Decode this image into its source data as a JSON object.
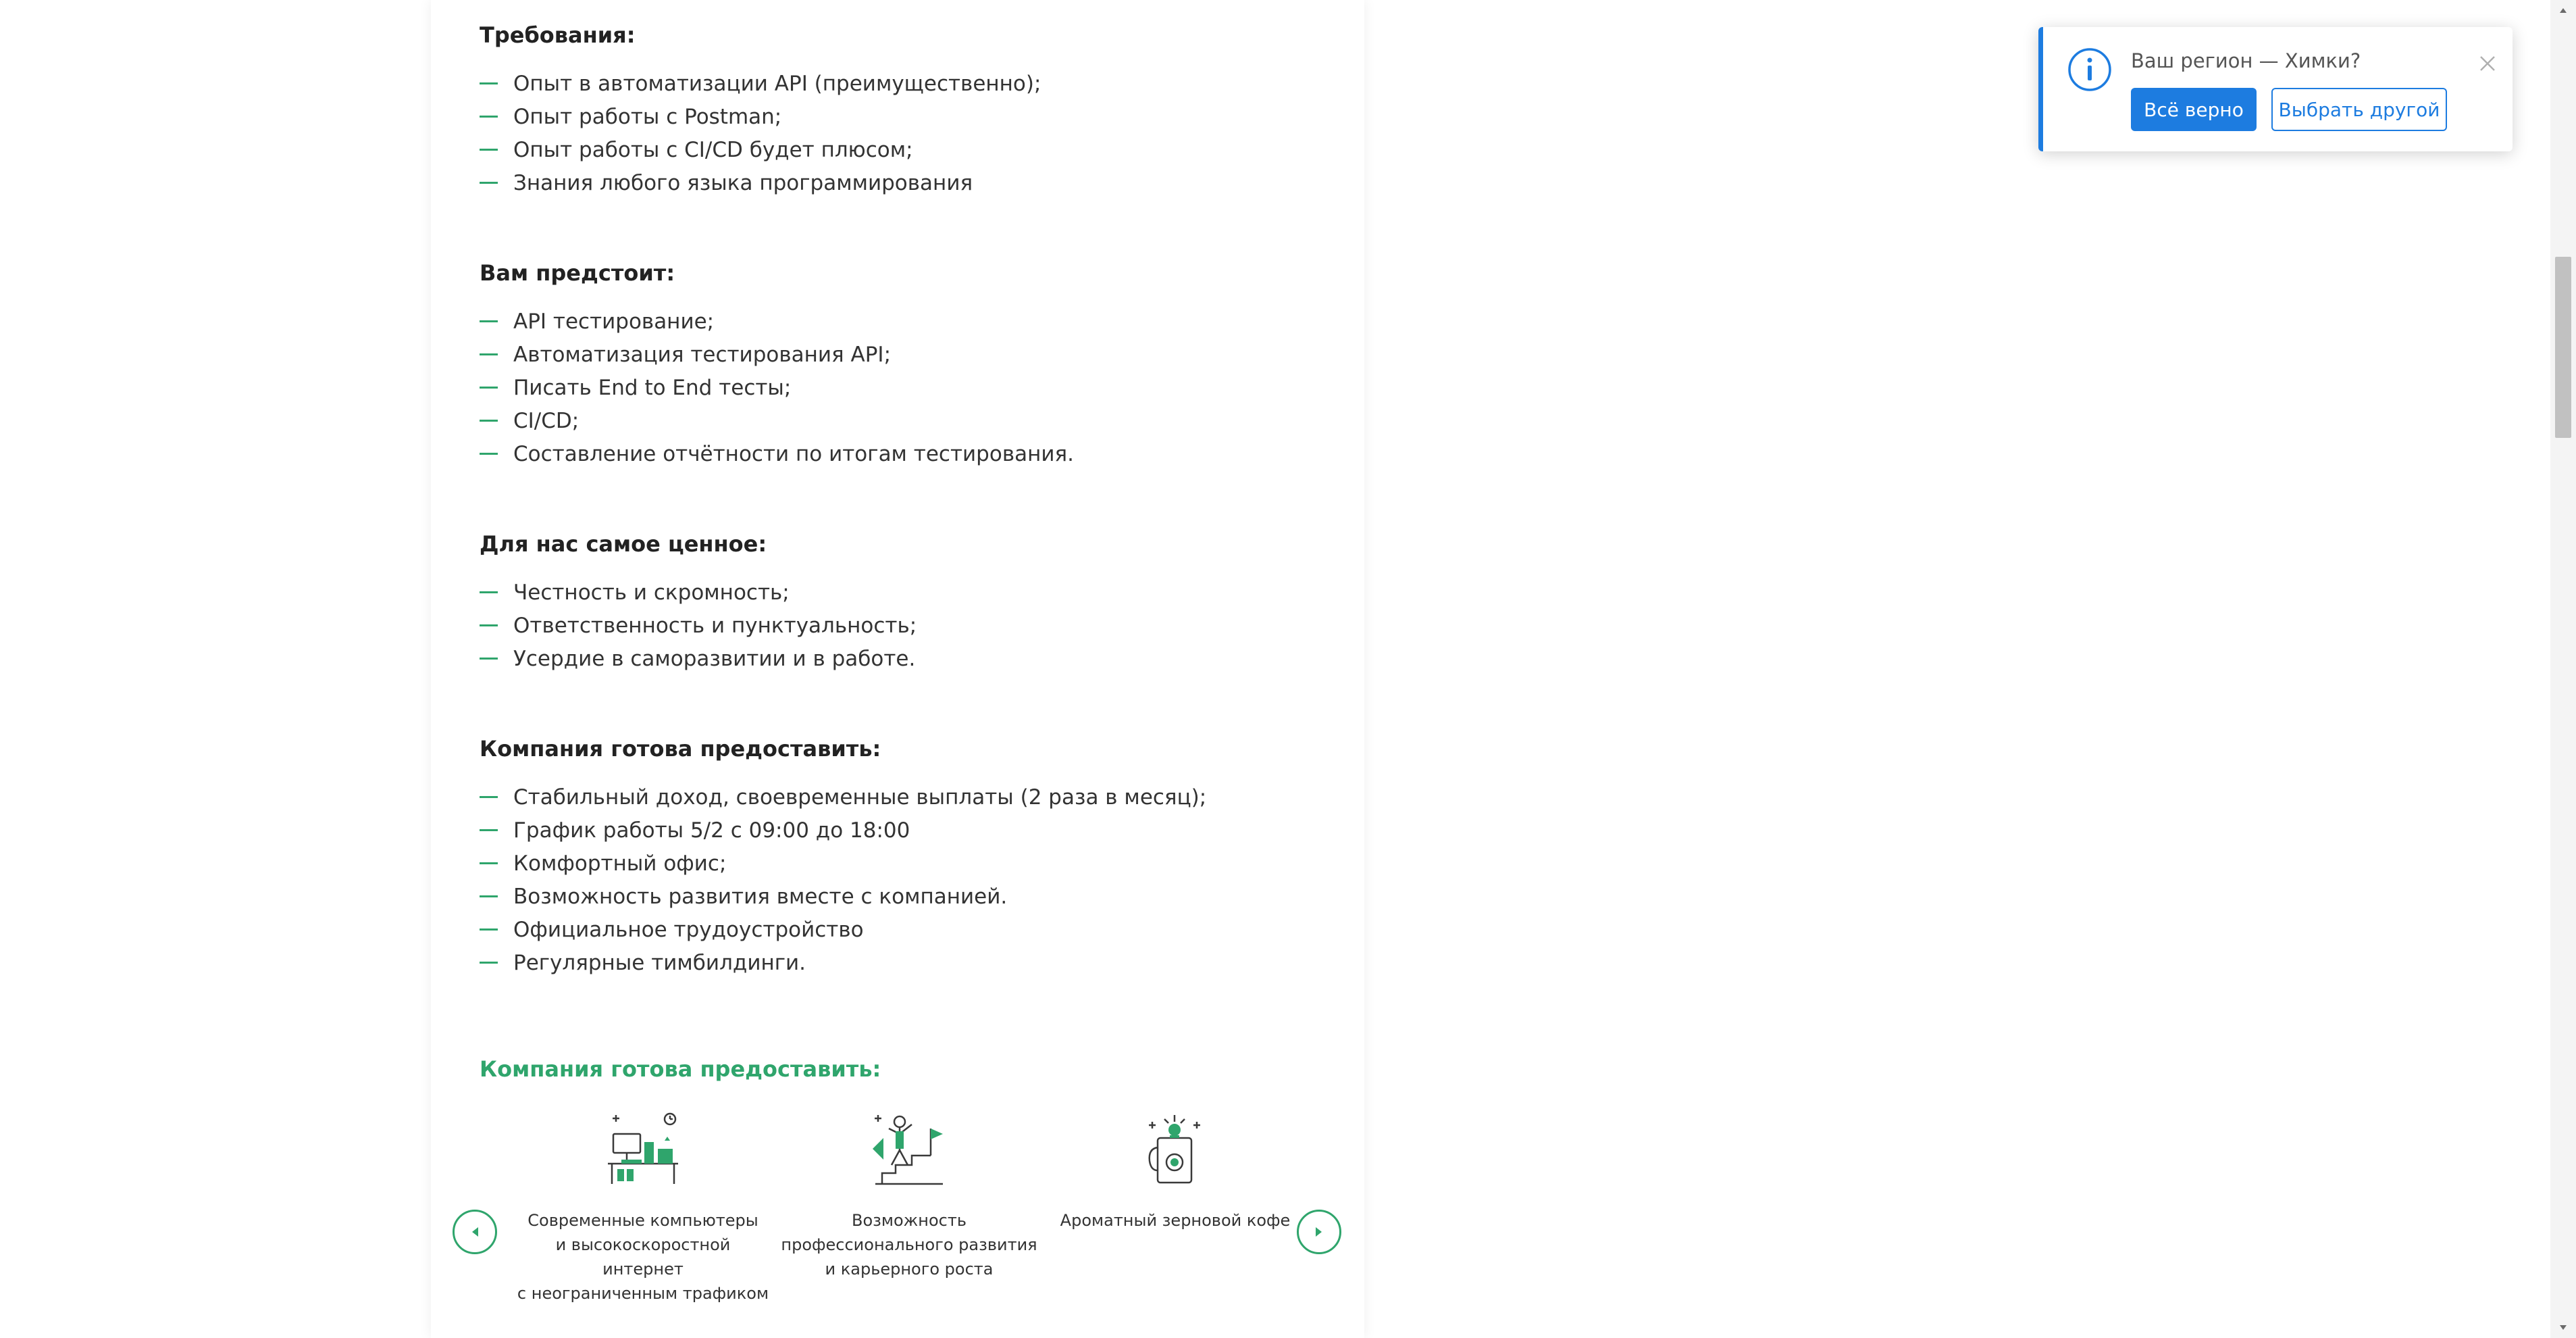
{
  "sections": [
    {
      "heading": "Требования:",
      "items": [
        "Опыт в автоматизации API (преимущественно);",
        "Опыт работы с Postman;",
        "Опыт работы с CI/CD будет плюсом;",
        "Знания любого языка программирования"
      ]
    },
    {
      "heading": "Вам предстоит:",
      "items": [
        "API тестирование;",
        "Автоматизация тестирования API;",
        "Писать End to End тесты;",
        "CI/CD;",
        "Составление отчётности по итогам тестирования."
      ]
    },
    {
      "heading": "Для нас самое ценное:",
      "items": [
        "Честность и скромность;",
        "Ответственность и пунктуальность;",
        "Усердие в саморазвитии и в работе."
      ]
    },
    {
      "heading": "Компания готова предоставить:",
      "items": [
        "Стабильный доход, своевременные выплаты (2 раза в месяц);",
        "График работы 5/2 с 09:00 до 18:00",
        "Комфортный офис;",
        "Возможность развития вместе с компанией.",
        "Официальное трудоустройство",
        "Регулярные тимбилдинги."
      ]
    }
  ],
  "benefits": {
    "heading": "Компания готова предоставить:",
    "items": [
      {
        "icon": "computer-desk-icon",
        "text": "Современные компьютеры\nи высокоскоростной интернет\nс неограниченным трафиком"
      },
      {
        "icon": "career-growth-icon",
        "text": "Возможность\nпрофессионального развития\nи карьерного роста"
      },
      {
        "icon": "coffee-cup-icon",
        "text": "Ароматный зерновой кофе"
      }
    ]
  },
  "region_popup": {
    "question": "Ваш регион — Химки?",
    "confirm_label": "Всё верно",
    "choose_other_label": "Выбрать другой"
  },
  "colors": {
    "accent_green": "#2fa56c",
    "primary_blue": "#1d7ce0"
  }
}
